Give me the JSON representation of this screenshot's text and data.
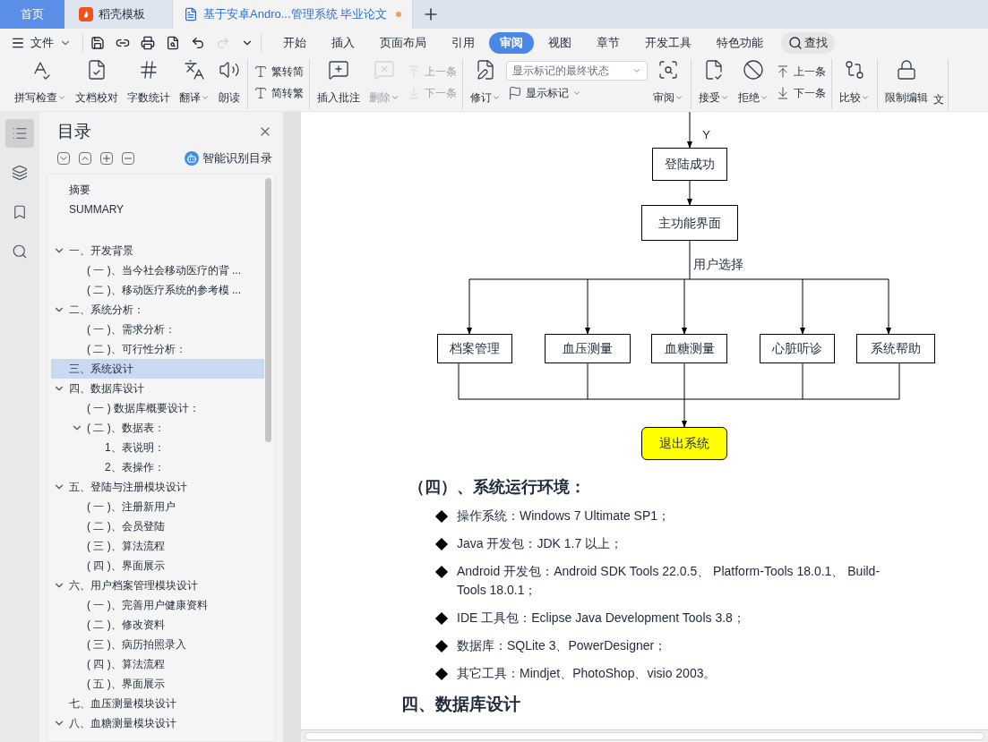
{
  "title_tabs": [
    {
      "label": "首页",
      "kind": "home",
      "selected": false
    },
    {
      "label": "稻壳模板",
      "kind": "template",
      "selected": false
    },
    {
      "label": "基于安卓Andro...管理系统 毕业论文",
      "kind": "document",
      "selected": true,
      "modified": true
    }
  ],
  "menu": {
    "file": "文件",
    "tabs": [
      {
        "label": "开始",
        "selected": false
      },
      {
        "label": "插入",
        "selected": false
      },
      {
        "label": "页面布局",
        "selected": false
      },
      {
        "label": "引用",
        "selected": false
      },
      {
        "label": "审阅",
        "selected": true
      },
      {
        "label": "视图",
        "selected": false
      },
      {
        "label": "章节",
        "selected": false
      },
      {
        "label": "开发工具",
        "selected": false
      },
      {
        "label": "特色功能",
        "selected": false
      }
    ],
    "search": "查找"
  },
  "ribbon": [
    [
      {
        "kind": "large",
        "label": "拼写检查",
        "dropdown": true,
        "disabled": false
      },
      {
        "kind": "large",
        "label": "文档校对",
        "dropdown": false,
        "disabled": false
      },
      {
        "kind": "large",
        "label": "字数统计",
        "dropdown": false,
        "disabled": false
      },
      {
        "kind": "large",
        "label": "翻译",
        "dropdown": true,
        "disabled": false
      },
      {
        "kind": "large",
        "label": "朗读",
        "dropdown": false,
        "disabled": false
      }
    ],
    [
      {
        "kind": "small",
        "label": "繁转简",
        "dropdown": false,
        "disabled": false
      },
      {
        "kind": "small",
        "label": "简转繁",
        "dropdown": false,
        "disabled": false
      }
    ],
    [
      {
        "kind": "large",
        "label": "插入批注",
        "dropdown": false,
        "disabled": false
      },
      {
        "kind": "large",
        "label": "删除",
        "dropdown": true,
        "disabled": true
      },
      {
        "kind": "small",
        "label": "上一条",
        "dropdown": false,
        "disabled": true
      },
      {
        "kind": "small",
        "label": "下一条",
        "dropdown": false,
        "disabled": true
      }
    ],
    [
      {
        "kind": "large",
        "label": "修订",
        "dropdown": true,
        "disabled": false
      },
      {
        "kind": "select",
        "label": "显示标记的最终状态",
        "dropdown": true,
        "disabled": false
      },
      {
        "kind": "small",
        "label": "显示标记",
        "dropdown": true,
        "disabled": false
      },
      {
        "kind": "large",
        "label": "审阅",
        "dropdown": true,
        "disabled": false
      }
    ],
    [
      {
        "kind": "large",
        "label": "接受",
        "dropdown": true,
        "disabled": false
      },
      {
        "kind": "large",
        "label": "拒绝",
        "dropdown": true,
        "disabled": false
      },
      {
        "kind": "small",
        "label": "上一条",
        "dropdown": false,
        "disabled": false
      },
      {
        "kind": "small",
        "label": "下一条",
        "dropdown": false,
        "disabled": false
      }
    ],
    [
      {
        "kind": "large",
        "label": "比较",
        "dropdown": true,
        "disabled": false
      }
    ],
    [
      {
        "kind": "large",
        "label": "限制编辑",
        "dropdown": false,
        "disabled": false
      },
      {
        "kind": "cut",
        "label": "文"
      }
    ]
  ],
  "rail": [
    {
      "selected": true
    },
    {
      "selected": false
    },
    {
      "selected": false
    },
    {
      "selected": false
    }
  ],
  "toc": {
    "title": "目录",
    "smart": "智能识别目录",
    "items": [
      {
        "text": "摘要",
        "selected": false
      },
      {
        "text": "SUMMARY",
        "selected": false
      },
      {
        "kind": "gap"
      },
      {
        "text": "一、开发背景",
        "selected": false,
        "expanded": true,
        "children": [
          {
            "text": "( 一 )、当今社会移动医疗的背 ...",
            "selected": false
          },
          {
            "text": "( 二 )、移动医疗系统的参考模 ...",
            "selected": false
          }
        ]
      },
      {
        "text": "二、系统分析：",
        "selected": false,
        "expanded": true,
        "children": [
          {
            "text": "( 一 )、需求分析：",
            "selected": false
          },
          {
            "text": "( 二 )、可行性分析：",
            "selected": false
          }
        ]
      },
      {
        "text": "三、系统设计",
        "selected": true
      },
      {
        "text": "四、数据库设计",
        "selected": false,
        "expanded": true,
        "children": [
          {
            "text": "( 一 ) 数据库概要设计：",
            "selected": false
          },
          {
            "text": "( 二 )、数据表：",
            "selected": false,
            "expanded": true,
            "children": [
              {
                "text": "1、表说明：",
                "selected": false
              },
              {
                "text": "2、表操作：",
                "selected": false
              }
            ]
          }
        ]
      },
      {
        "text": "五、登陆与注册模块设计",
        "selected": false,
        "expanded": true,
        "children": [
          {
            "text": "( 一 )、注册新用户",
            "selected": false
          },
          {
            "text": "( 二 )、会员登陆",
            "selected": false
          },
          {
            "text": "( 三 )、算法流程",
            "selected": false
          },
          {
            "text": "( 四 )、界面展示",
            "selected": false
          }
        ]
      },
      {
        "text": "六、用户档案管理模块设计",
        "selected": false,
        "expanded": true,
        "children": [
          {
            "text": "( 一 )、完善用户健康资料",
            "selected": false
          },
          {
            "text": "( 二 )、修改资料",
            "selected": false
          },
          {
            "text": "( 三 )、病历拍照录入",
            "selected": false
          },
          {
            "text": "( 四 )、算法流程",
            "selected": false
          },
          {
            "text": "( 五 )、界面展示",
            "selected": false
          }
        ]
      },
      {
        "text": "七、血压测量模块设计",
        "selected": false
      },
      {
        "text": "八、血糖测量模块设计",
        "selected": false,
        "expanded": true
      }
    ]
  },
  "flowchart": {
    "edge_labels": [
      "Y",
      "用户选择"
    ],
    "nodes": [
      {
        "label": "登陆成功",
        "kind": "process"
      },
      {
        "label": "主功能界面",
        "kind": "process"
      },
      {
        "label": "档案管理",
        "kind": "process"
      },
      {
        "label": "血压测量",
        "kind": "process"
      },
      {
        "label": "血糖测量",
        "kind": "process"
      },
      {
        "label": "心脏听诊",
        "kind": "process"
      },
      {
        "label": "系统帮助",
        "kind": "process"
      },
      {
        "label": "退出系统",
        "kind": "terminal"
      }
    ]
  },
  "document": {
    "heading": "（四）、系统运行环境：",
    "bullets": [
      "操作系统：Windows 7 Ultimate SP1；",
      "Java 开发包：JDK 1.7 以上；",
      "Android 开发包：Android SDK Tools 22.0.5、 Platform-Tools 18.0.1、 Build-Tools 18.0.1；",
      "IDE 工具包：Eclipse Java Development Tools 3.8；",
      "数据库：SQLite 3、PowerDesigner；",
      "其它工具：Mindjet、PhotoShop、visio 2003。"
    ],
    "next_heading": "四、数据库设计"
  }
}
